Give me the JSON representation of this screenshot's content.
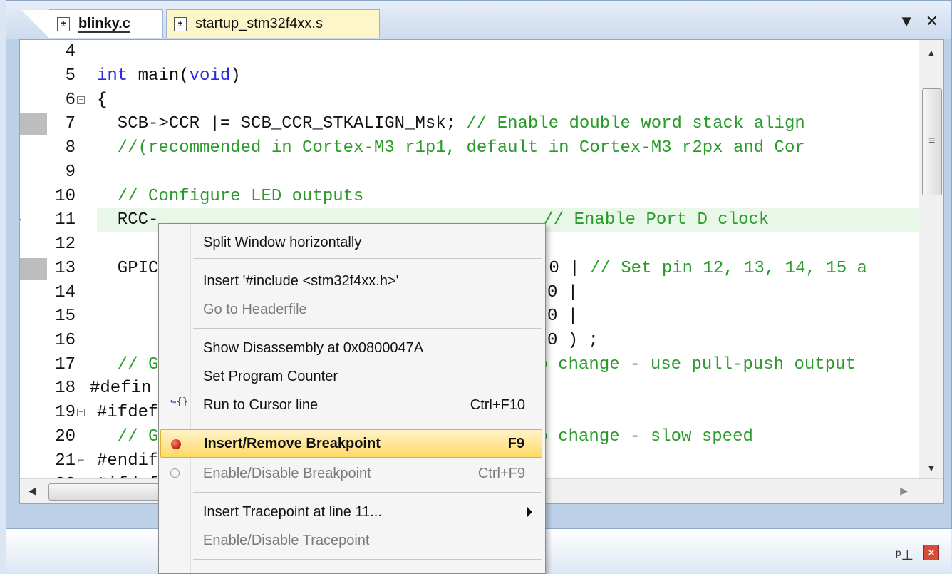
{
  "tabs": [
    {
      "label": "blinky.c",
      "active": true
    },
    {
      "label": "startup_stm32f4xx.s",
      "active": false
    }
  ],
  "tab_controls": {
    "dropdown_glyph": "▼",
    "close_glyph": "✕"
  },
  "code_lines": [
    {
      "num": "4",
      "text": ""
    },
    {
      "num": "5",
      "text": "int main(void)"
    },
    {
      "num": "6",
      "text": "{"
    },
    {
      "num": "7",
      "text": "  SCB->CCR |= SCB_CCR_STKALIGN_Msk; // Enable double word stack align"
    },
    {
      "num": "8",
      "text": "  //(recommended in Cortex-M3 r1p1, default in Cortex-M3 r2px and Cor"
    },
    {
      "num": "9",
      "text": ""
    },
    {
      "num": "10",
      "text": "  // Configure LED outputs"
    },
    {
      "num": "11",
      "text": "  RCC->AHB1ENR |= RCC_AHB1ENR_GPIODEN; // Enable Port D clock"
    },
    {
      "num": "12",
      "text": ""
    },
    {
      "num": "13",
      "text": "  GPIOD->MODER = (1 << 24) | (1 << 26) | (1 << 28) | (1 << 30 | // Set pin 12, 13, 14, 15 a"
    },
    {
      "num": "14",
      "text": "                              0 |"
    },
    {
      "num": "15",
      "text": "                              0 |"
    },
    {
      "num": "16",
      "text": "                              0 ) ;"
    },
    {
      "num": "17",
      "text": "  // G                                        o change - use pull-push output"
    },
    {
      "num": "18",
      "text": "#defin"
    },
    {
      "num": "19",
      "text": "#ifdef"
    },
    {
      "num": "20",
      "text": "  // G                                        o change - slow speed"
    },
    {
      "num": "21",
      "text": "#endif"
    },
    {
      "num": "22",
      "text": "#ifdef"
    }
  ],
  "visible_code": {
    "l4": "",
    "l5_kw1": "int",
    "l5_mid": " main(",
    "l5_kw2": "void",
    "l5_end": ")",
    "l6": "{",
    "l7_code": "  SCB->CCR |= SCB_CCR_STKALIGN_Msk; ",
    "l7_cm": "// Enable double word stack align",
    "l8_cm": "  //(recommended in Cortex-M3 r1p1, default in Cortex-M3 r2px and Cor",
    "l9": "",
    "l10_cm": "  // Configure LED outputs",
    "l11_code": "  RCC-",
    "l11_tail": "0 |",
    "l11_cm": "// Enable Port D clock",
    "l12": "",
    "l13_code": "  GPIC",
    "l13_tail": "0 | ",
    "l13_cm": "// Set pin 12, 13, 14, 15 a",
    "l14_tail": "0 |",
    "l15_tail": "0 |",
    "l16_tail": "0 ) ;",
    "l17_cm": "  // G",
    "l17_tail_cm": "o change - use pull-push output",
    "l18": "#defin",
    "l19": "#ifdef",
    "l20_cm": "  // G",
    "l20_tail_cm": "o change - slow speed",
    "l21": "#endif",
    "l22": "#ifdef"
  },
  "current_line": "11",
  "context_menu": {
    "items": [
      {
        "label": "Split Window horizontally",
        "shortcut": "",
        "enabled": true
      },
      {
        "label": "Insert '#include <stm32f4xx.h>'",
        "shortcut": "",
        "enabled": true
      },
      {
        "label": "Go to Headerfile",
        "shortcut": "",
        "enabled": false
      },
      {
        "label": "Show Disassembly at 0x0800047A",
        "shortcut": "",
        "enabled": true
      },
      {
        "label": "Set Program Counter",
        "shortcut": "",
        "enabled": true
      },
      {
        "label": "Run to Cursor line",
        "shortcut": "Ctrl+F10",
        "enabled": true,
        "icon": "run-to-cursor-icon",
        "icon_glyph": "↪{}"
      },
      {
        "label": "Insert/Remove Breakpoint",
        "shortcut": "F9",
        "enabled": true,
        "highlighted": true,
        "icon": "breakpoint-icon"
      },
      {
        "label": "Enable/Disable Breakpoint",
        "shortcut": "Ctrl+F9",
        "enabled": false,
        "icon": "breakpoint-hollow-icon"
      },
      {
        "label": "Insert Tracepoint at line 11...",
        "shortcut": "",
        "enabled": true,
        "submenu": true
      },
      {
        "label": "Enable/Disable Tracepoint",
        "shortcut": "",
        "enabled": false
      }
    ]
  },
  "bottom_bar": {
    "pin_glyph": "📌",
    "close_glyph": "✕"
  },
  "colors": {
    "keyword": "#2a2ae0",
    "comment": "#2a9a2a",
    "highlight": "#ffd966",
    "current_line_bg": "#e8f7e8"
  }
}
